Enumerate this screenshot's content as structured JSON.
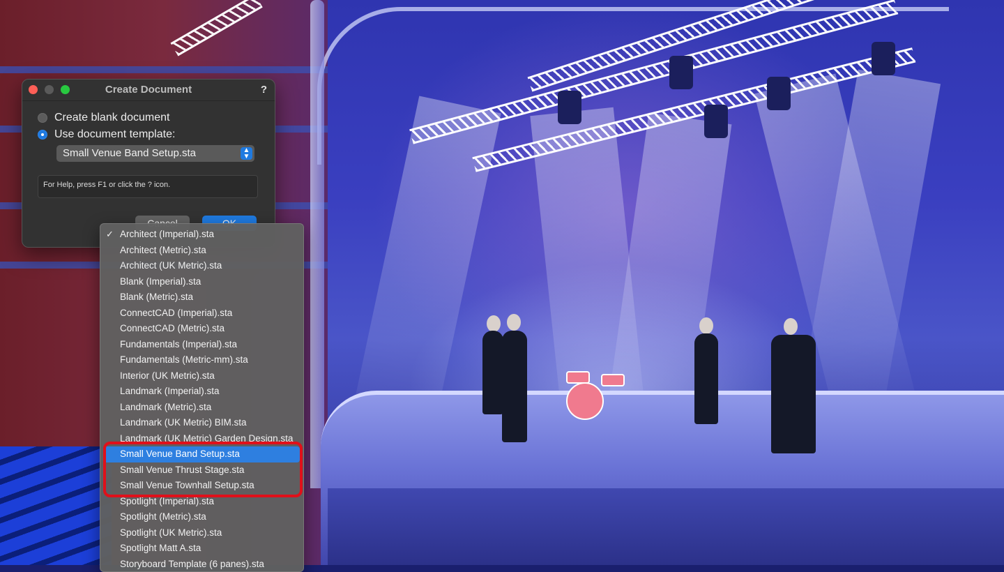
{
  "dialog": {
    "title": "Create Document",
    "help_label": "?",
    "option_blank": "Create blank document",
    "option_template": "Use document template:",
    "template_selected": "Small Venue Band Setup.sta",
    "help_text": "For Help, press F1 or click the ? icon.",
    "cancel_label": "Cancel",
    "ok_label": "OK"
  },
  "dropdown": {
    "checkmark": "✓",
    "items": [
      "Architect (Imperial).sta",
      "Architect (Metric).sta",
      "Architect (UK Metric).sta",
      "Blank (Imperial).sta",
      "Blank (Metric).sta",
      "ConnectCAD (Imperial).sta",
      "ConnectCAD (Metric).sta",
      "Fundamentals (Imperial).sta",
      "Fundamentals (Metric-mm).sta",
      "Interior (UK Metric).sta",
      "Landmark (Imperial).sta",
      "Landmark (Metric).sta",
      "Landmark (UK Metric) BIM.sta",
      "Landmark (UK Metric) Garden Design.sta",
      "Small Venue Band Setup.sta",
      "Small Venue Thrust Stage.sta",
      "Small Venue Townhall Setup.sta",
      "Spotlight (Imperial).sta",
      "Spotlight (Metric).sta",
      "Spotlight (UK Metric).sta",
      "Spotlight Matt A.sta",
      "Storyboard Template (6 panes).sta"
    ],
    "checked_index": 0,
    "highlighted_index": 14
  },
  "colors": {
    "accent": "#2e7fe0",
    "highlight_ring": "#e0101a",
    "dialog_bg": "#323232",
    "menu_bg": "#606060"
  }
}
